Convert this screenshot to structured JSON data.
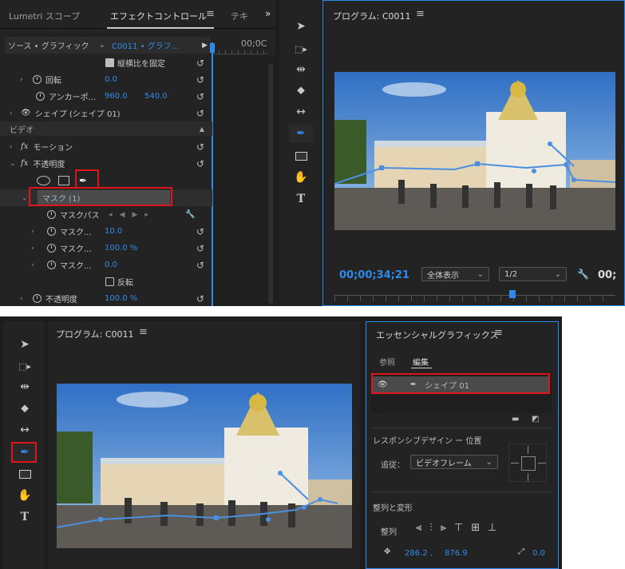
{
  "effects_panel": {
    "tabs": [
      "Lumetri スコープ",
      "エフェクトコントロール",
      "テキ"
    ],
    "source_label": "ソース • グラフィック",
    "clip_label": "C0011 • グラフ...",
    "timecode_top": "00;0C",
    "rows": {
      "maintain_aspect": "縦横比を固定",
      "rotation_label": "回転",
      "rotation_value": "0.0",
      "anchor_label": "アンカーポ...",
      "anchor_x": "960.0",
      "anchor_y": "540.0",
      "shape_label": "シェイプ (シェイプ 01)",
      "video_section": "ビデオ",
      "motion_label": "モーション",
      "opacity_label": "不透明度",
      "mask_label": "マスク (1)",
      "mask_path_label": "マスクパス",
      "mask_feather_label": "マスク...",
      "mask_feather_value": "10.0",
      "mask_opacity_label": "マスク...",
      "mask_opacity_value": "100.0 %",
      "mask_expansion_label": "マスク...",
      "mask_expansion_value": "0.0",
      "inverted_label": "反転",
      "opacity2_label": "不透明度",
      "opacity2_value": "100.0 %"
    }
  },
  "program_top": {
    "title": "プログラム: C0011",
    "timecode": "00;00;34;21",
    "zoom": "全体表示",
    "resolution": "1/2",
    "extra": "00;"
  },
  "program_bottom": {
    "title": "プログラム: C0011"
  },
  "essential_graphics": {
    "title": "エッセンシャルグラフィックス",
    "tabs": [
      "参照",
      "編集"
    ],
    "layer_name": "シェイプ 01",
    "responsive_label": "レスポンシブデザイン ー 位置",
    "follow_label": "追従：",
    "follow_value": "ビデオフレーム",
    "align_transform": "整列と変形",
    "align_label": "整列",
    "pos_x": "286.2",
    "pos_y": "876.9",
    "rotation": "0.0"
  },
  "colors": {
    "accent": "#2d8ceb",
    "highlight": "#e0141b",
    "panel": "#232323"
  }
}
